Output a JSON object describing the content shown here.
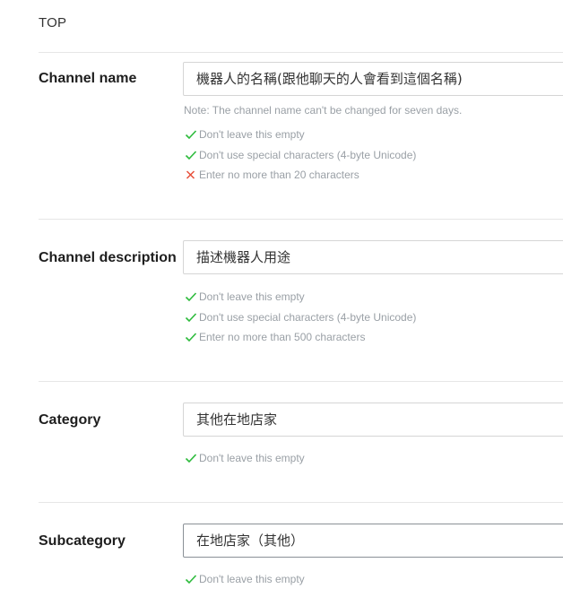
{
  "header": {
    "title": "TOP"
  },
  "colors": {
    "ok": "#2dbb3c",
    "error": "#e8503a"
  },
  "fields": [
    {
      "label": "Channel name",
      "value": "機器人的名稱(跟他聊天的人會看到這個名稱)",
      "note": "Note: The channel name can't be changed for seven days.",
      "rules": [
        {
          "status": "ok",
          "icon": "check-icon",
          "text": "Don't leave this empty"
        },
        {
          "status": "ok",
          "icon": "check-icon",
          "text": "Don't use special characters (4-byte Unicode)"
        },
        {
          "status": "error",
          "icon": "cross-icon",
          "text": "Enter no more than 20 characters"
        }
      ]
    },
    {
      "label": "Channel description",
      "value": "描述機器人用途",
      "rules": [
        {
          "status": "ok",
          "icon": "check-icon",
          "text": "Don't leave this empty"
        },
        {
          "status": "ok",
          "icon": "check-icon",
          "text": "Don't use special characters (4-byte Unicode)"
        },
        {
          "status": "ok",
          "icon": "check-icon",
          "text": "Enter no more than 500 characters"
        }
      ]
    },
    {
      "label": "Category",
      "value": "其他在地店家",
      "rules": [
        {
          "status": "ok",
          "icon": "check-icon",
          "text": "Don't leave this empty"
        }
      ]
    },
    {
      "label": "Subcategory",
      "value": "在地店家（其他）",
      "rules": [
        {
          "status": "ok",
          "icon": "check-icon",
          "text": "Don't leave this empty"
        }
      ]
    }
  ]
}
